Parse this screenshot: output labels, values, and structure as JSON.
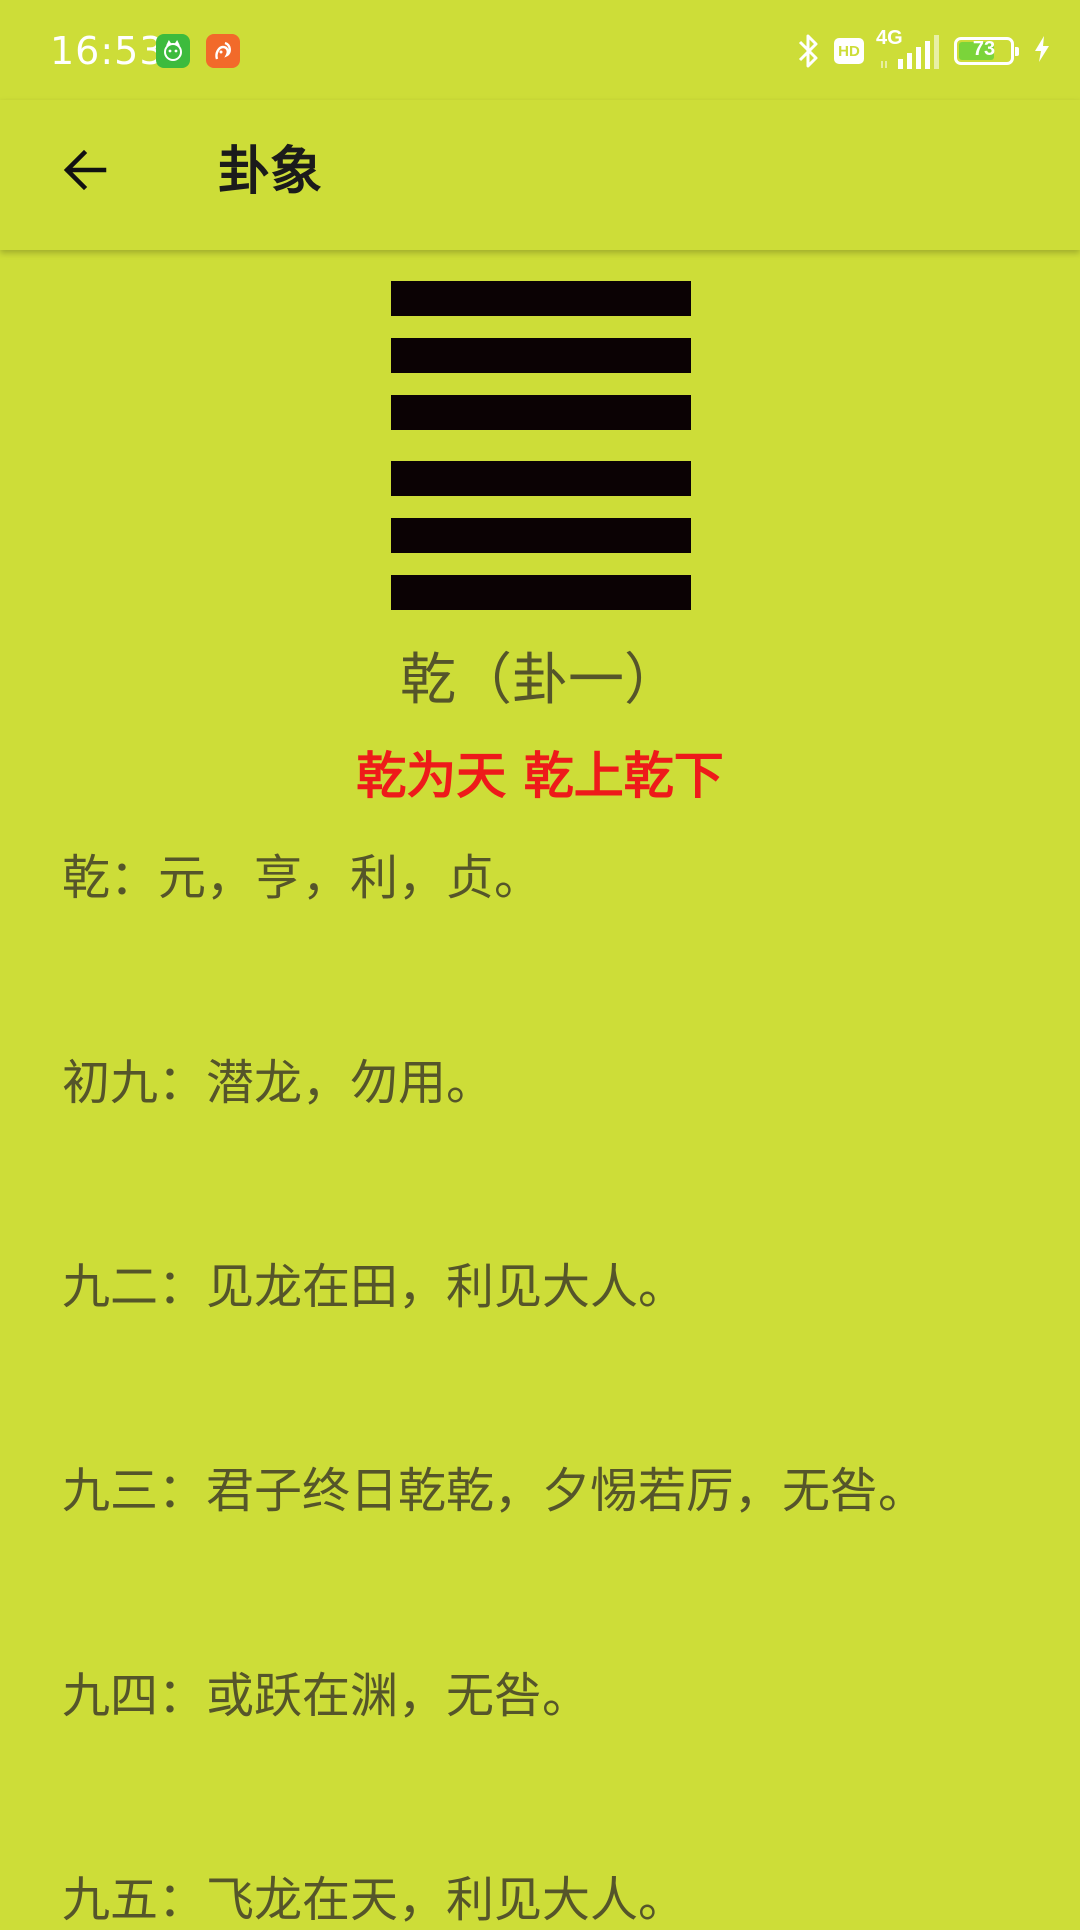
{
  "status_bar": {
    "time": "16:53",
    "network": "4G",
    "hd": "HD",
    "battery": "73",
    "battery_level": 0.73
  },
  "app_bar": {
    "title": "卦象"
  },
  "hexagram": {
    "lines": [
      "yang",
      "yang",
      "yang",
      "yang",
      "yang",
      "yang"
    ],
    "name": "乾（卦一）",
    "subtitle": "乾为天 乾上乾下"
  },
  "texts": [
    "乾：元，亨，利，贞。",
    "初九：潜龙，勿用。",
    "九二：见龙在田，利见大人。",
    "九三：君子终日乾乾，夕惕若厉，无咎。",
    "九四：或跃在渊，无咎。",
    "九五：飞龙在天，利见大人。"
  ],
  "colors": {
    "background": "#cddd38",
    "hexagram_line": "#0b0204",
    "body_text": "#55552a",
    "subtitle": "#ee1a1a"
  }
}
